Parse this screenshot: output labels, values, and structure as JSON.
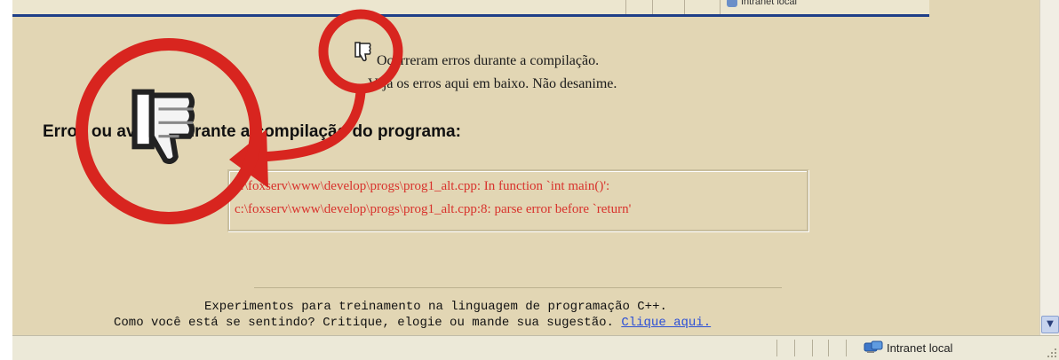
{
  "top_inset": {
    "zone_label": "Intranet local"
  },
  "message": {
    "line1": "Ocorreram erros durante a compilação.",
    "line2": "Veja os erros aqui em baixo. Não desanime."
  },
  "heading": "Erros ou avisos durante a compilação do programa:",
  "errors": [
    "c:\\foxserv\\www\\develop\\progs\\prog1_alt.cpp: In function `int main()':",
    "c:\\foxserv\\www\\develop\\progs\\prog1_alt.cpp:8: parse error before `return'"
  ],
  "footer": {
    "line1": "Experimentos para treinamento na linguagem de programação C++.",
    "line2_text": "Como você está se sentindo? Critique, elogie ou mande sua sugestão.",
    "link": "Clique aqui."
  },
  "statusbar": {
    "zone_label": "Intranet local"
  },
  "icons": {
    "thumbs_down": "thumbs-down-icon",
    "zone": "intranet-zone-icon"
  },
  "colors": {
    "page_bg": "#e2d6b4",
    "error_text": "#d8322c",
    "annotation_red": "#d8251f",
    "link": "#2b4fd6"
  }
}
